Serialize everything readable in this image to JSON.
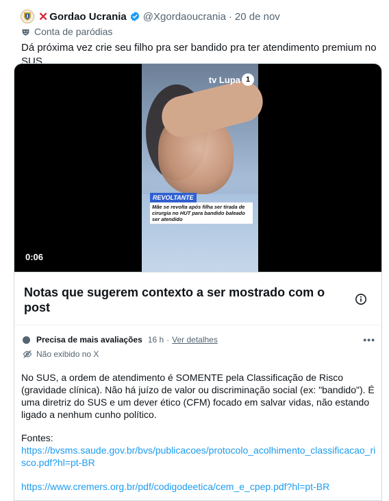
{
  "post": {
    "display_name": "Gordao Ucrania",
    "x_mark": "✕",
    "handle": "@Xgordaoucrania",
    "separator": "·",
    "date": "20 de nov",
    "parody_label": "Conta de paródias",
    "text": "Dá próxima vez crie seu filho pra ser bandido pra ter atendimento premium no SUS"
  },
  "video": {
    "channel_logo": "tv Lupa",
    "channel_logo_number": "1",
    "tag": "REVOLTANTE",
    "caption": "Mãe se revolta após filha ser tirada de cirurgia no HUT para bandido baleado ser atendido",
    "duration": "0:06"
  },
  "notes": {
    "title": "Notas que sugerem contexto a ser mostrado com o post",
    "status": "Precisa de mais avaliações",
    "time": "16 h",
    "separator": "·",
    "details_link": "Ver detalhes",
    "shown_status": "Não exibido no X",
    "body": "No SUS, a ordem de atendimento é SOMENTE pela Classificação de Risco (gravidade clínica). Não há juízo de valor ou discriminação social (ex: \"bandido\"). É uma diretriz do SUS e um dever ético (CFM) focado em salvar vidas, não estando ligado a nenhum cunho político.",
    "sources_label": "Fontes:",
    "source_links": [
      "https://bvsms.saude.gov.br/bvs/publicacoes/protocolo_acolhimento_classificacao_risco.pdf?hl=pt-BR",
      "https://www.cremers.org.br/pdf/codigodeetica/cem_e_cpep.pdf?hl=pt-BR"
    ]
  },
  "colors": {
    "text_primary": "#0f1419",
    "text_secondary": "#536471",
    "link": "#1d9bf0",
    "verified": "#1d9bf0",
    "x_mark": "#d7263d",
    "border": "#cfd9de"
  },
  "icons": {
    "verified": "verified-badge-icon",
    "parody": "parody-mask-icon",
    "info": "info-icon",
    "more": "more-options-icon",
    "hidden": "eye-off-icon"
  }
}
